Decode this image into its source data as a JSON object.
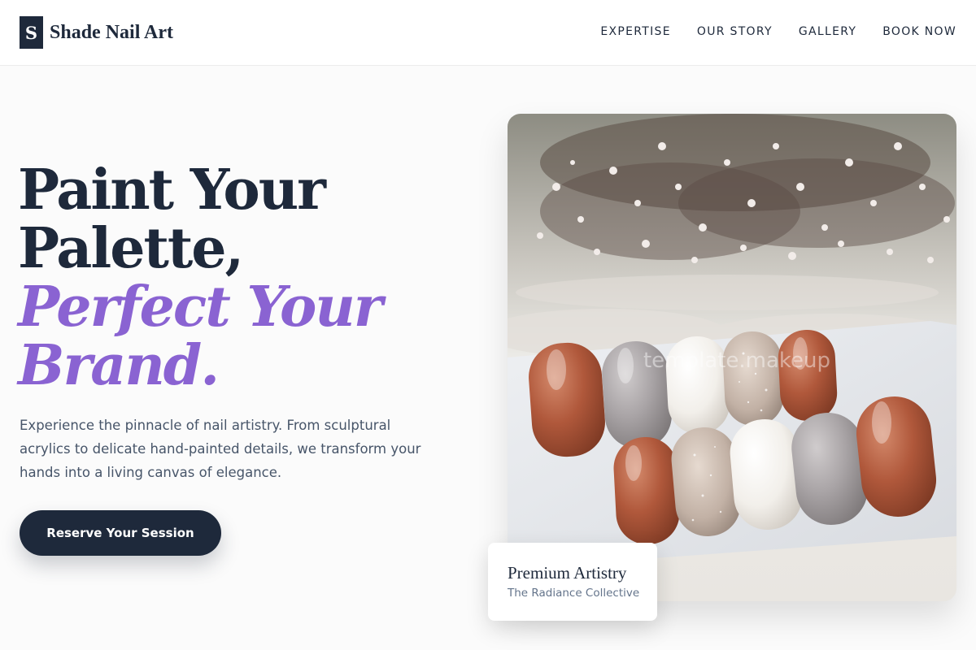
{
  "brand": {
    "logo_letter": "S",
    "name": "Shade Nail Art"
  },
  "nav": {
    "items": [
      "EXPERTISE",
      "OUR STORY",
      "GALLERY",
      "BOOK NOW"
    ]
  },
  "hero": {
    "title_line1": "Paint Your",
    "title_line2": "Palette,",
    "title_line3": "Perfect Your",
    "title_line4": "Brand.",
    "description": "Experience the pinnacle of nail artistry. From sculptural acrylics to delicate hand-painted details, we transform your hands into a living canvas of elegance.",
    "cta_label": "Reserve Your Session"
  },
  "photo": {
    "watermark": "template.makeup"
  },
  "caption": {
    "title": "Premium Artistry",
    "subtitle": "The Radiance Collective"
  },
  "colors": {
    "primary": "#1e293b",
    "accent": "#8a63d2",
    "text_muted": "#475569",
    "nail_terracotta": "#b0583b",
    "nail_grey": "#a9a4a6",
    "nail_white": "#f2efea",
    "nail_glitter": "#cbbcb0"
  }
}
